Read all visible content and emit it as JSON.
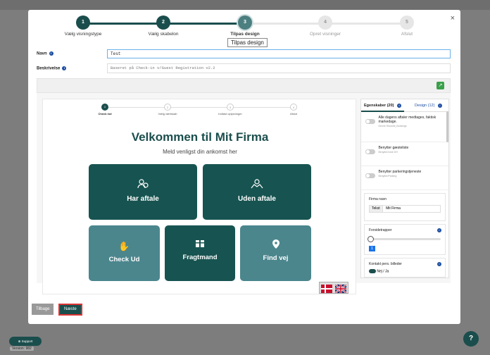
{
  "wizard": {
    "close": "×",
    "steps": [
      {
        "num": "1",
        "label": "Vælg visningstype"
      },
      {
        "num": "2",
        "label": "Vælg skabelon"
      },
      {
        "num": "3",
        "label": "Tilpas design"
      },
      {
        "num": "4",
        "label": "Opret visninger"
      },
      {
        "num": "5",
        "label": "Afslut"
      }
    ],
    "tooltip": "Tilpas design"
  },
  "form": {
    "name_label": "Navn",
    "name_value": "Test",
    "desc_label": "Beskrivelse",
    "desc_value": "Baseret på Check-in v/Guest Registration v2.2"
  },
  "preview": {
    "steps": [
      {
        "num": "1",
        "label": "Check ind"
      },
      {
        "num": "2",
        "label": "Vælg værtskab"
      },
      {
        "num": "3",
        "label": "Indtast oplysninger"
      },
      {
        "num": "4",
        "label": "Afslut"
      }
    ],
    "title": "Velkommen til Mit Firma",
    "subtitle": "Meld venligst din ankomst her",
    "tiles": [
      {
        "label": "Har aftale"
      },
      {
        "label": "Uden aftale"
      },
      {
        "label": "Check Ud"
      },
      {
        "label": "Fragtmand"
      },
      {
        "label": "Find vej"
      }
    ]
  },
  "panel": {
    "tab1": "Egenskaber (20)",
    "tab2": "Design (12)",
    "props": [
      {
        "title": "Alle dagens aftaler medtages, faktisk",
        "title2": "markedage.",
        "sub": "Denne ShowAll_Bookings"
      },
      {
        "title": "Benytter gæsteliste",
        "sub": "Benytter/Liste DH"
      },
      {
        "title": "Benytter parkeringstjeneste",
        "sub": "Benytter/Parking"
      }
    ],
    "firm_label": "Firma navn",
    "firm_tag": "Tekst",
    "firm_value": "Mit Firma",
    "slider_label": "Forsidetrapper",
    "slider_value": "1",
    "contact_label": "Kontakt pers. billeder",
    "contact_value": "Nej / Ja"
  },
  "footer": {
    "back": "Tilbage",
    "next": "Næste",
    "support": "Support",
    "version": "Version: 982",
    "help": "?"
  },
  "colors": {
    "primary": "#1a4e4d",
    "tile_dark": "#175451",
    "tile_light": "#4b868d"
  }
}
